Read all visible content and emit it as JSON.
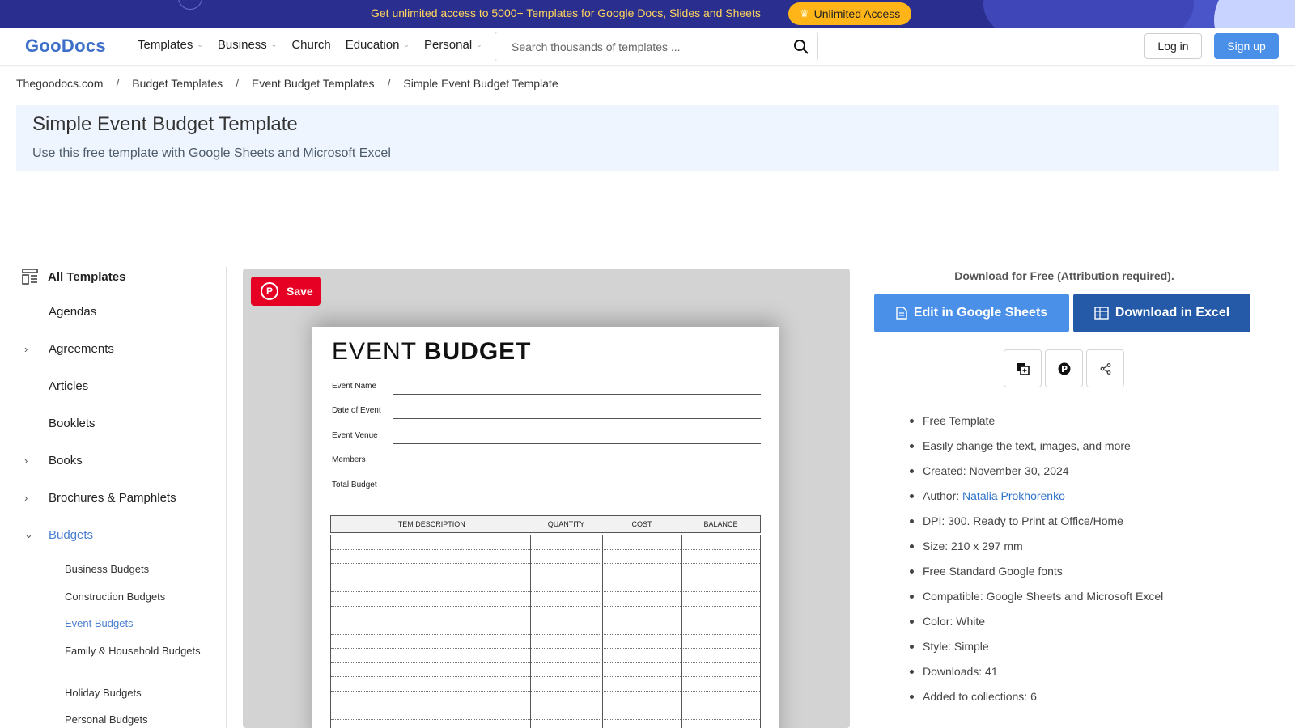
{
  "promo": {
    "text": "Get unlimited access to 5000+ Templates for Google Docs, Slides and Sheets",
    "button": "Unlimited Access",
    "icon": "crown-icon"
  },
  "header": {
    "logo": "GooDocs",
    "nav": [
      "Templates",
      "Business",
      "Church",
      "Education",
      "Personal"
    ],
    "search_placeholder": "Search thousands of templates ...",
    "login": "Log in",
    "signup": "Sign up"
  },
  "breadcrumb": [
    "Thegoodocs.com",
    "Budget Templates",
    "Event Budget Templates",
    "Simple Event Budget Template"
  ],
  "breadcrumb_sep": "/",
  "title": "Simple Event Budget Template",
  "subtitle": "Use this free template with Google Sheets and Microsoft Excel",
  "sidebar": {
    "all_templates": "All Templates",
    "categories": [
      {
        "label": "Agendas",
        "has_arrow": false
      },
      {
        "label": "Agreements",
        "has_arrow": true
      },
      {
        "label": "Articles",
        "has_arrow": false
      },
      {
        "label": "Booklets",
        "has_arrow": false
      },
      {
        "label": "Books",
        "has_arrow": true
      },
      {
        "label": "Brochures & Pamphlets",
        "has_arrow": true
      },
      {
        "label": "Budgets",
        "has_arrow": true,
        "expanded": true
      }
    ],
    "subcategories": [
      "Business Budgets",
      "Construction Budgets",
      "Event Budgets",
      "Family & Household Budgets",
      "Holiday Budgets",
      "Personal Budgets"
    ],
    "active_subcategory": "Event Budgets"
  },
  "preview": {
    "save": "Save",
    "doc_title_light": "EVENT",
    "doc_title_bold": "BUDGET",
    "fields": [
      "Event Name",
      "Date of Event",
      "Event Venue",
      "Members",
      "Total Budget"
    ],
    "columns": [
      "ITEM DESCRIPTION",
      "QUANTITY",
      "COST",
      "BALANCE"
    ]
  },
  "download": {
    "note": "Download for Free (Attribution required).",
    "edit": "Edit in Google Sheets",
    "excel": "Download in Excel"
  },
  "features": [
    "Free Template",
    "Easily change the text, images, and more",
    "Created: November 30, 2024",
    "DPI: 300. Ready to Print at Office/Home",
    "Size: 210 x 297 mm",
    "Free Standard Google fonts",
    "Compatible: Google Sheets and Microsoft Excel",
    "Color: White",
    "Style: Simple",
    "Downloads: 41",
    "Added to collections: 6"
  ],
  "author": {
    "prefix": "Author: ",
    "name": "Natalia Prokhorenko"
  },
  "colors": {
    "accent": "#4a90e8",
    "excel": "#255aa8",
    "pinterest": "#e60023",
    "promo_bg": "#2a2f8f",
    "promo_btn": "#ffb518"
  }
}
